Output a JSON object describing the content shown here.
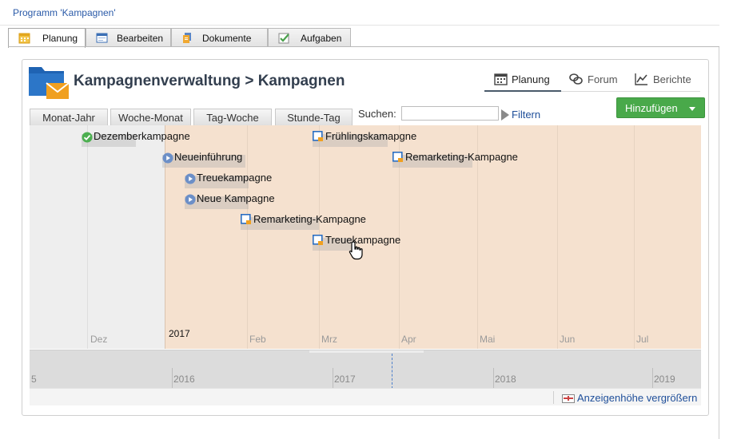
{
  "window": {
    "title": "Programm 'Kampagnen'"
  },
  "doc_tabs": [
    {
      "label": "Planung",
      "icon": "calendar-icon",
      "active": true
    },
    {
      "label": "Bearbeiten",
      "icon": "edit-form-icon",
      "active": false
    },
    {
      "label": "Dokumente",
      "icon": "documents-icon",
      "active": false
    },
    {
      "label": "Aufgaben",
      "icon": "task-check-icon",
      "active": false
    }
  ],
  "header": {
    "icon": "campaign-folder-icon",
    "title": "Kampagnenverwaltung > Kampagnen"
  },
  "view_tabs": [
    {
      "label": "Planung",
      "icon": "calendar-icon",
      "active": true
    },
    {
      "label": "Forum",
      "icon": "forum-icon",
      "active": false
    },
    {
      "label": "Berichte",
      "icon": "chart-icon",
      "active": false
    }
  ],
  "toolbar": {
    "add_label": "Hinzufügen",
    "scale_tabs": [
      "Monat-Jahr",
      "Woche-Monat",
      "Tag-Woche",
      "Stunde-Tag"
    ],
    "search_label": "Suchen:",
    "search_value": "",
    "filter_label": "Filtern"
  },
  "timeline": {
    "year_label": "2017",
    "months": [
      "Dez",
      "Feb",
      "Mrz",
      "Apr",
      "Mai",
      "Jun",
      "Jul"
    ],
    "events": [
      {
        "label": "Dezemberkampagne",
        "status": "completed",
        "icon": "check-circle-icon"
      },
      {
        "label": "Frühlingskamapgne",
        "status": "planned",
        "icon": "campaign-planned-icon"
      },
      {
        "label": "Remarketing-Kampagne",
        "status": "planned",
        "icon": "campaign-planned-icon"
      },
      {
        "label": "Neueinführung",
        "status": "running",
        "icon": "play-circle-icon"
      },
      {
        "label": "Treuekampagne",
        "status": "running",
        "icon": "play-circle-icon"
      },
      {
        "label": "Neue Kampagne",
        "status": "running",
        "icon": "play-circle-icon"
      },
      {
        "label": "Remarketing-Kampagne",
        "status": "planned",
        "icon": "campaign-planned-icon"
      },
      {
        "label": "Treuekampagne",
        "status": "planned",
        "icon": "campaign-planned-icon"
      }
    ]
  },
  "overview": {
    "years": [
      "5",
      "2016",
      "2017",
      "2018",
      "2019"
    ]
  },
  "footer": {
    "enlarge_label": "Anzeigenhöhe vergrößern"
  },
  "colors": {
    "accent_blue": "#1f4f9a",
    "add_button_green": "#49a94a",
    "timeline_future": "#f5e1cf",
    "timeline_past": "#eeeeee",
    "completed_green": "#4caf50",
    "running_blue": "#6c8fc7"
  }
}
